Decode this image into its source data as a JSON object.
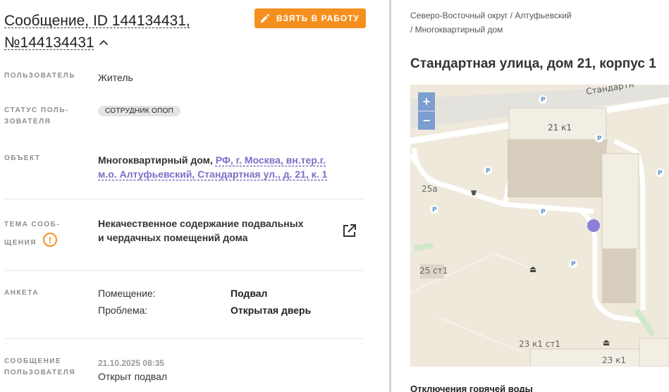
{
  "header": {
    "title_line1": "Сообщение, ID 144134431,",
    "title_line2": "№144134431",
    "take_button": "ВЗЯТЬ В РАБОТУ"
  },
  "fields": {
    "user_label": "ПОЛЬЗОВАТЕЛЬ",
    "user_value": "Житель",
    "status_label_1": "СТАТУС ПОЛЬ-",
    "status_label_2": "ЗОВАТЕЛЯ",
    "status_badge": "СОТРУДНИК ОПОП",
    "object_label": "ОБЪЕКТ",
    "object_prefix": "Многоквартирный дом, ",
    "object_link": "РФ, г. Москва, вн.тер.г. м.о. Алтуфьевский, Стандартная ул., д. 21, к. 1",
    "theme_label_1": "ТЕМА СООБ-",
    "theme_label_2": "ЩЕНИЯ",
    "theme_warning": "!",
    "theme_value": "Некачественное содержание подвальных и чердачных помещений дома",
    "survey_label": "АНКЕТА",
    "survey": [
      {
        "key": "Помещение:",
        "value": "Подвал"
      },
      {
        "key": "Проблема:",
        "value": "Открытая дверь"
      }
    ],
    "message_label_1": "СООБЩЕНИЕ",
    "message_label_2": "ПОЛЬЗОВАТЕЛЯ",
    "message_date": "21.10.2025 08:35",
    "message_text": "Открыт подвал"
  },
  "right": {
    "breadcrumb_1": "Северо-Восточный округ / Алтуфьевский",
    "breadcrumb_2": "/ Многоквартирный дом",
    "address": "Стандартная улица, дом 21, корпус 1",
    "section_title": "Отключения горячей воды"
  },
  "map": {
    "zoom_in": "+",
    "zoom_out": "−",
    "street_label": "Стандартн",
    "buildings": [
      "21 к1",
      "25а",
      "25 ст1",
      "23 к1 ст1",
      "23 к1"
    ],
    "parking_symbol": "P",
    "marker_color": "#8b7fd8"
  },
  "colors": {
    "accent": "#f5901e",
    "link": "#7b6fc7"
  }
}
